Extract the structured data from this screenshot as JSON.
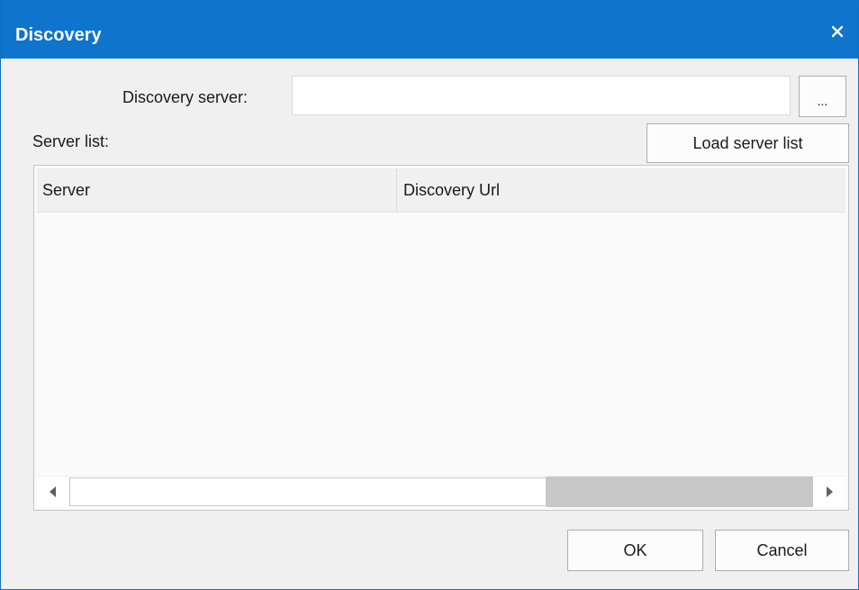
{
  "window": {
    "title": "Discovery",
    "close_icon": "close-icon",
    "accent_color": "#0e74cc"
  },
  "form": {
    "discovery_server_label": "Discovery server:",
    "discovery_server_value": "",
    "browse_label": "...",
    "server_list_label": "Server list:",
    "load_server_list_label": "Load server list"
  },
  "server_list": {
    "columns": [
      "Server",
      "Discovery Url"
    ],
    "rows": []
  },
  "scrollbar": {
    "left_arrow_icon": "scroll-left-arrow-icon",
    "right_arrow_icon": "scroll-right-arrow-icon"
  },
  "footer": {
    "ok_label": "OK",
    "cancel_label": "Cancel"
  }
}
